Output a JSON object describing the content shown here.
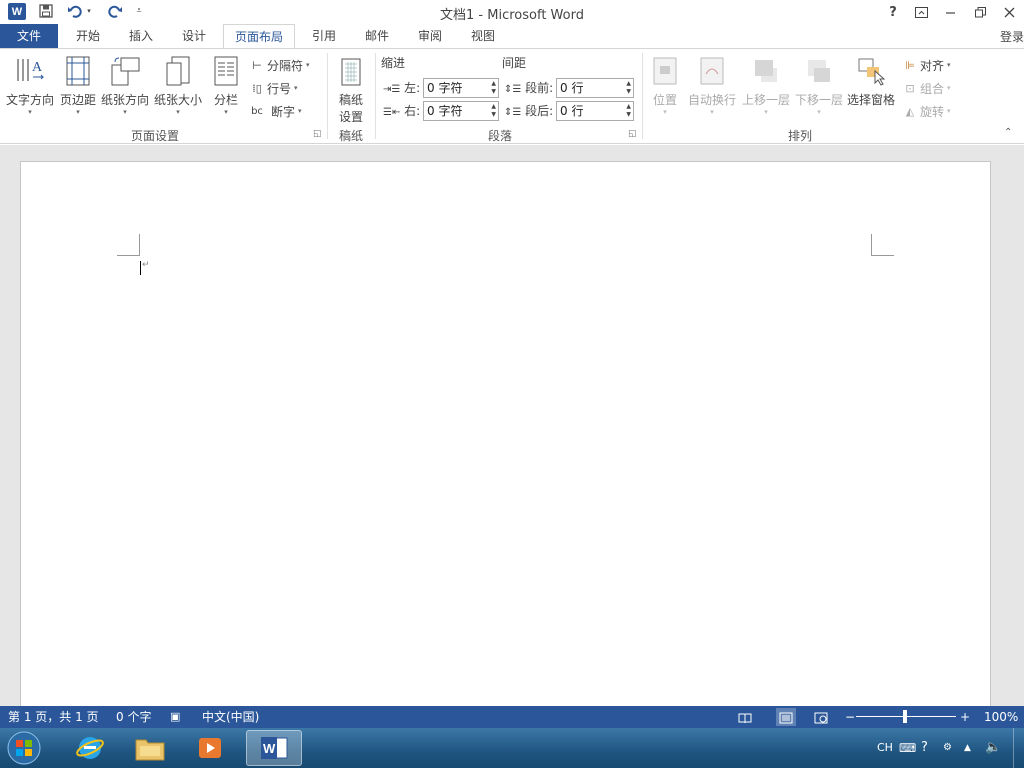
{
  "window": {
    "title": "文档1 - Microsoft Word",
    "help": "?",
    "login": "登录"
  },
  "tabs": [
    "文件",
    "开始",
    "插入",
    "设计",
    "页面布局",
    "引用",
    "邮件",
    "审阅",
    "视图"
  ],
  "ribbon": {
    "page_setup": {
      "text_direction": "文字方向",
      "margins": "页边距",
      "orientation": "纸张方向",
      "size": "纸张大小",
      "columns": "分栏",
      "breaks": "分隔符",
      "line_numbers": "行号",
      "hyphenation": "断字",
      "group_label": "页面设置"
    },
    "draft_paper": {
      "button_line1": "稿纸",
      "button_line2": "设置",
      "group_label": "稿纸"
    },
    "paragraph": {
      "indent_header": "缩进",
      "spacing_header": "间距",
      "left_label": "左:",
      "right_label": "右:",
      "left_value": "0 字符",
      "right_value": "0 字符",
      "before_label": "段前:",
      "after_label": "段后:",
      "before_value": "0 行",
      "after_value": "0 行",
      "group_label": "段落"
    },
    "arrange": {
      "position": "位置",
      "wrap_text": "自动换行",
      "bring_forward": "上移一层",
      "send_backward": "下移一层",
      "selection_pane": "选择窗格",
      "align": "对齐",
      "group": "组合",
      "rotate": "旋转",
      "group_label": "排列"
    }
  },
  "status": {
    "page": "第 1 页，共 1 页",
    "words": "0 个字",
    "language": "中文(中国)",
    "zoom": "100%"
  },
  "taskbar": {
    "ime": "CH"
  },
  "colors": {
    "accent": "#2b579a",
    "taskbar": "#1f5580"
  }
}
